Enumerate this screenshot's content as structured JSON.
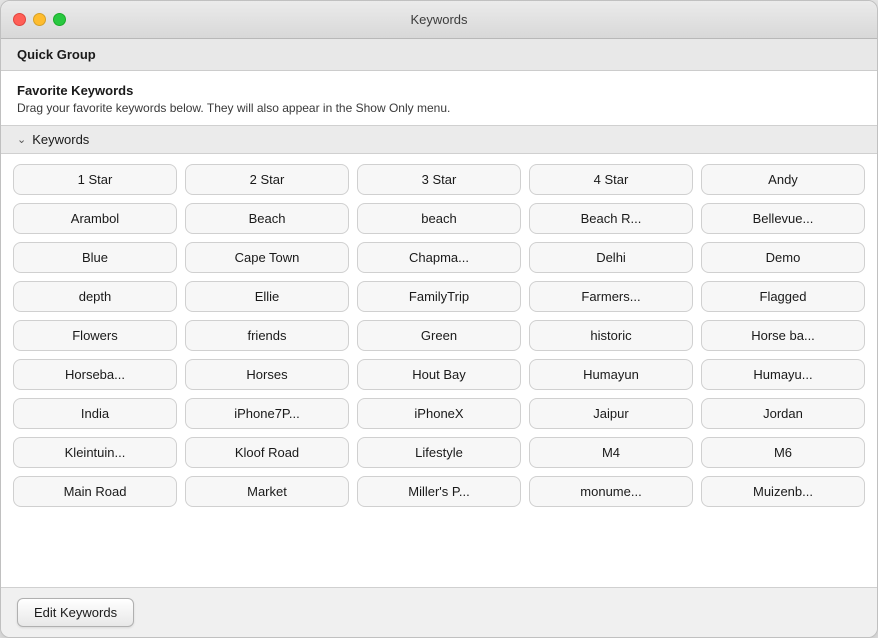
{
  "window": {
    "title": "Keywords"
  },
  "titleBar": {
    "title": "Keywords"
  },
  "quickGroup": {
    "label": "Quick Group"
  },
  "favoriteSection": {
    "title": "Favorite Keywords",
    "description": "Drag your favorite keywords below. They will also appear in the Show Only menu."
  },
  "keywordsHeader": {
    "label": "Keywords",
    "chevron": "⌄"
  },
  "keywords": [
    "1 Star",
    "2 Star",
    "3 Star",
    "4 Star",
    "Andy",
    "Arambol",
    "Beach",
    "beach",
    "Beach R...",
    "Bellevue...",
    "Blue",
    "Cape Town",
    "Chapma...",
    "Delhi",
    "Demo",
    "depth",
    "Ellie",
    "FamilyTrip",
    "Farmers...",
    "Flagged",
    "Flowers",
    "friends",
    "Green",
    "historic",
    "Horse ba...",
    "Horseba...",
    "Horses",
    "Hout Bay",
    "Humayun",
    "Humayu...",
    "India",
    "iPhone7P...",
    "iPhoneX",
    "Jaipur",
    "Jordan",
    "Kleintuin...",
    "Kloof Road",
    "Lifestyle",
    "M4",
    "M6",
    "Main Road",
    "Market",
    "Miller's P...",
    "monume...",
    "Muizenb..."
  ],
  "footer": {
    "editButtonLabel": "Edit Keywords"
  }
}
